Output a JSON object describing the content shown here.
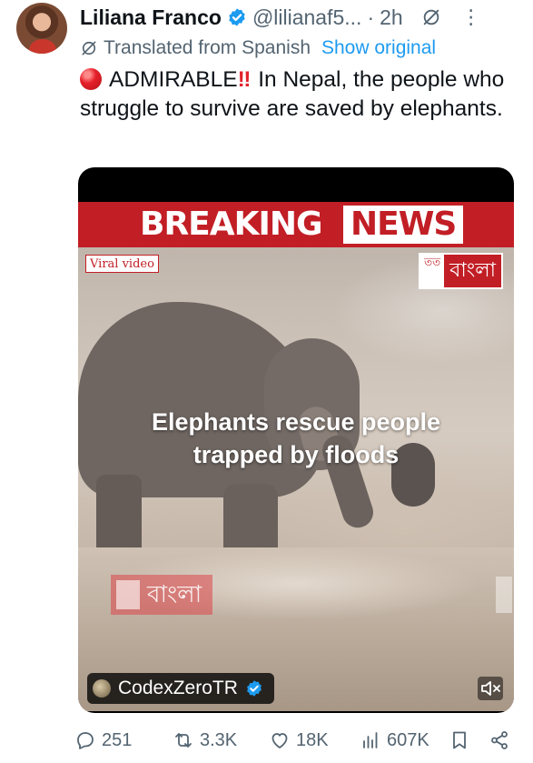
{
  "author": {
    "name": "Liliana Franco",
    "handle": "@lilianaf5...",
    "separator": "·",
    "time": "2h"
  },
  "translation": {
    "label": "Translated from Spanish",
    "show_original": "Show original"
  },
  "tweet": {
    "headline": "ADMIRABLE",
    "emoji_bang": "‼",
    "body": "In Nepal, the people who struggle to survive are saved by elephants."
  },
  "media": {
    "banner_breaking": "BREAKING",
    "banner_news": "NEWS",
    "viral_tag": "Viral video",
    "channel_logo_box": "তত",
    "channel_logo_text": "বাংলা",
    "caption_line1": "Elephants rescue people",
    "caption_line2": "trapped by floods",
    "watermark_text": "বাংলা",
    "attribution": "CodexZeroTR"
  },
  "actions": {
    "replies": "251",
    "reposts": "3.3K",
    "likes": "18K",
    "views": "607K"
  },
  "colors": {
    "link_blue": "#1d9bf0",
    "muted_gray": "#536471",
    "breaking_red": "#c21e25"
  },
  "icons": [
    "verified-badge-icon",
    "grok-icon",
    "more-icon",
    "translate-icon",
    "reply-icon",
    "repost-icon",
    "like-icon",
    "views-icon",
    "bookmark-icon",
    "share-icon",
    "mute-icon"
  ]
}
